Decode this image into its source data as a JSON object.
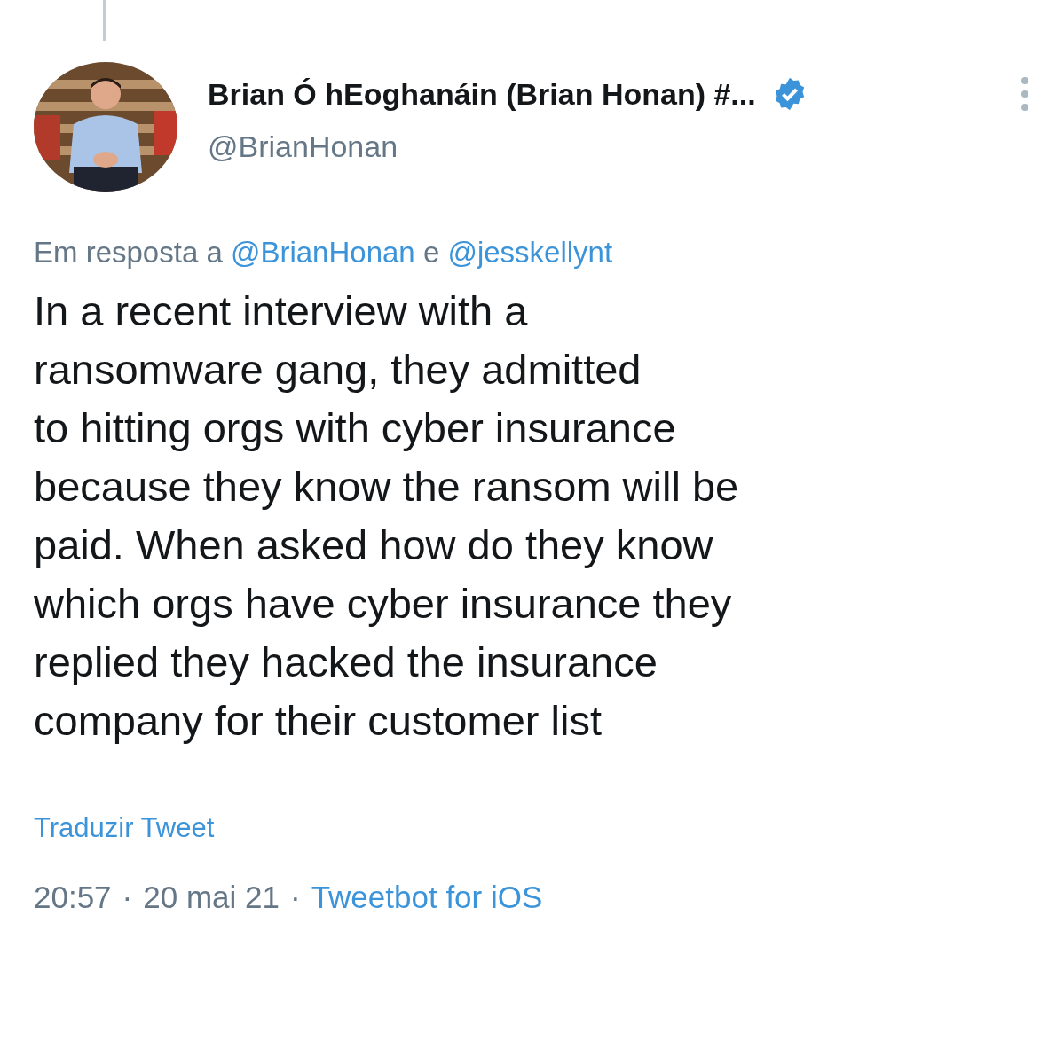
{
  "author": {
    "name": "Brian Ó hEoghanáin (Brian Honan) #...",
    "verified": true,
    "handle": "@BrianHonan"
  },
  "reply_to": {
    "label": "Em resposta a",
    "mentions": [
      "@BrianHonan",
      "@jesskellynt"
    ],
    "conjunction": "e"
  },
  "body": "In a recent interview with a\nransomware gang, they admitted\nto hitting orgs with cyber insurance\nbecause they know the ransom will be\npaid. When asked how do they know\nwhich  orgs have cyber insurance they\nreplied they hacked the insurance\ncompany for their customer list",
  "translate": "Traduzir Tweet",
  "meta": {
    "time": "20:57",
    "separator": "·",
    "date": "20 mai 21",
    "source": "Tweetbot for iOS"
  }
}
